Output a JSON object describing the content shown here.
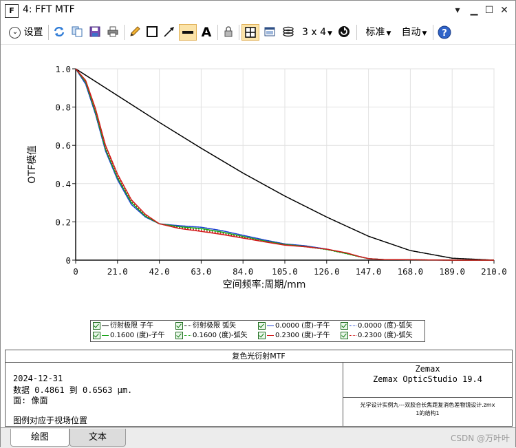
{
  "window": {
    "title": "4: FFT MTF",
    "app_icon_letter": "F"
  },
  "toolbar": {
    "settings_label": "设置",
    "grid_label": "3 x 4",
    "standard_label": "标准",
    "auto_label": "自动"
  },
  "chart_data": {
    "type": "line",
    "xlabel": "空间频率:周期/mm",
    "ylabel": "OTF模值",
    "xlim": [
      0,
      210
    ],
    "ylim": [
      0,
      1.0
    ],
    "x_ticks": [
      "0",
      "21.0",
      "42.0",
      "63.0",
      "84.0",
      "105.0",
      "126.0",
      "147.0",
      "168.0",
      "189.0",
      "210.0"
    ],
    "y_ticks": [
      "0",
      "0.2",
      "0.4",
      "0.6",
      "0.8",
      "1.0"
    ],
    "grid": true,
    "series": [
      {
        "name": "衍射极限 子午",
        "color": "#000000",
        "dash": "solid",
        "x": [
          0,
          21,
          42,
          63,
          84,
          105,
          126,
          147,
          168,
          189,
          210
        ],
        "y": [
          1.0,
          0.86,
          0.72,
          0.585,
          0.455,
          0.335,
          0.225,
          0.125,
          0.05,
          0.01,
          0.0
        ]
      },
      {
        "name": "衍射极限 弧矢",
        "color": "#000000",
        "dash": "dotted",
        "x": [
          0,
          21,
          42,
          63,
          84,
          105,
          126,
          147,
          168,
          189,
          210
        ],
        "y": [
          1.0,
          0.86,
          0.72,
          0.585,
          0.455,
          0.335,
          0.225,
          0.125,
          0.05,
          0.01,
          0.0
        ]
      },
      {
        "name": "0.0000 (度) 子午",
        "color": "#1d3fd1",
        "dash": "solid",
        "x": [
          0,
          5,
          10,
          15,
          21,
          28,
          35,
          42,
          52,
          63,
          73,
          84,
          95,
          105,
          115,
          126,
          136,
          142,
          147,
          155,
          168,
          189,
          210
        ],
        "y": [
          1.0,
          0.92,
          0.76,
          0.57,
          0.42,
          0.29,
          0.225,
          0.19,
          0.18,
          0.172,
          0.155,
          0.13,
          0.105,
          0.085,
          0.075,
          0.058,
          0.035,
          0.02,
          0.008,
          0.003,
          0.002,
          0.0,
          0.0
        ]
      },
      {
        "name": "0.0000 (度) 弧矢",
        "color": "#1d3fd1",
        "dash": "dotted",
        "x": [
          0,
          5,
          10,
          15,
          21,
          28,
          35,
          42,
          52,
          63,
          73,
          84,
          95,
          105,
          115,
          126,
          136,
          142,
          147,
          155,
          168,
          189,
          210
        ],
        "y": [
          1.0,
          0.92,
          0.76,
          0.57,
          0.42,
          0.29,
          0.225,
          0.19,
          0.18,
          0.172,
          0.155,
          0.13,
          0.105,
          0.085,
          0.075,
          0.058,
          0.035,
          0.02,
          0.008,
          0.003,
          0.002,
          0.0,
          0.0
        ]
      },
      {
        "name": "0.1600 (度) 子午",
        "color": "#19a319",
        "dash": "solid",
        "x": [
          0,
          5,
          10,
          15,
          21,
          28,
          35,
          42,
          52,
          63,
          73,
          84,
          95,
          105,
          115,
          126,
          136,
          142,
          147,
          155,
          168,
          189,
          210
        ],
        "y": [
          1.0,
          0.93,
          0.77,
          0.58,
          0.43,
          0.3,
          0.23,
          0.19,
          0.175,
          0.165,
          0.148,
          0.124,
          0.1,
          0.082,
          0.072,
          0.056,
          0.034,
          0.019,
          0.008,
          0.003,
          0.002,
          0.0,
          0.0
        ]
      },
      {
        "name": "0.1600 (度) 弧矢",
        "color": "#19a319",
        "dash": "dotted",
        "x": [
          0,
          5,
          10,
          15,
          21,
          28,
          35,
          42,
          52,
          63,
          73,
          84,
          95,
          105,
          115,
          126,
          136,
          142,
          147,
          155,
          168,
          189,
          210
        ],
        "y": [
          1.0,
          0.93,
          0.775,
          0.585,
          0.435,
          0.305,
          0.232,
          0.19,
          0.172,
          0.162,
          0.145,
          0.121,
          0.098,
          0.08,
          0.07,
          0.055,
          0.033,
          0.018,
          0.008,
          0.003,
          0.002,
          0.0,
          0.0
        ]
      },
      {
        "name": "0.2300 (度) 子午",
        "color": "#d11a1a",
        "dash": "solid",
        "x": [
          0,
          5,
          10,
          15,
          21,
          28,
          35,
          42,
          52,
          63,
          73,
          84,
          95,
          105,
          115,
          126,
          136,
          142,
          147,
          155,
          168,
          189,
          210
        ],
        "y": [
          1.0,
          0.94,
          0.79,
          0.6,
          0.45,
          0.315,
          0.24,
          0.19,
          0.165,
          0.15,
          0.135,
          0.115,
          0.095,
          0.078,
          0.07,
          0.058,
          0.038,
          0.02,
          0.008,
          0.003,
          0.002,
          0.0,
          0.0
        ]
      },
      {
        "name": "0.2300 (度) 弧矢",
        "color": "#d11a1a",
        "dash": "dotted",
        "x": [
          0,
          5,
          10,
          15,
          21,
          28,
          35,
          42,
          52,
          63,
          73,
          84,
          95,
          105,
          115,
          126,
          136,
          142,
          147,
          155,
          168,
          189,
          210
        ],
        "y": [
          1.0,
          0.935,
          0.78,
          0.59,
          0.44,
          0.31,
          0.236,
          0.19,
          0.168,
          0.155,
          0.14,
          0.118,
          0.097,
          0.08,
          0.071,
          0.057,
          0.037,
          0.02,
          0.008,
          0.003,
          0.002,
          0.0,
          0.0
        ]
      }
    ]
  },
  "legend": {
    "items": [
      {
        "label": "衍射极限 子午",
        "color": "#000000",
        "dash": "solid"
      },
      {
        "label": "衍射极限 弧矢",
        "color": "#000000",
        "dash": "dotted"
      },
      {
        "label": "0.0000 (度)-子午",
        "color": "#1d3fd1",
        "dash": "solid"
      },
      {
        "label": "0.0000 (度)-弧矢",
        "color": "#1d3fd1",
        "dash": "dotted"
      },
      {
        "label": "0.1600 (度)-子午",
        "color": "#19a319",
        "dash": "solid"
      },
      {
        "label": "0.1600 (度)-弧矢",
        "color": "#19a319",
        "dash": "dotted"
      },
      {
        "label": "0.2300 (度)-子午",
        "color": "#d11a1a",
        "dash": "solid"
      },
      {
        "label": "0.2300 (度)-弧矢",
        "color": "#d11a1a",
        "dash": "dotted"
      }
    ]
  },
  "info": {
    "title": "复色光衍射MTF",
    "date": "2024-12-31",
    "data_line": "数据 0.4861 到 0.6563 μm.",
    "surface_line": "面: 像面",
    "legend_note": "图例对应于视场位置",
    "company": "Zemax",
    "product": "Zemax OpticStudio 19.4",
    "file_line": "光学设计实例九---双胶合长焦距复消色差物镜设计.zmx",
    "config_line": "1的结构1"
  },
  "tabs": [
    {
      "label": "绘图"
    },
    {
      "label": "文本"
    }
  ],
  "watermark": "CSDN @万叶叶"
}
